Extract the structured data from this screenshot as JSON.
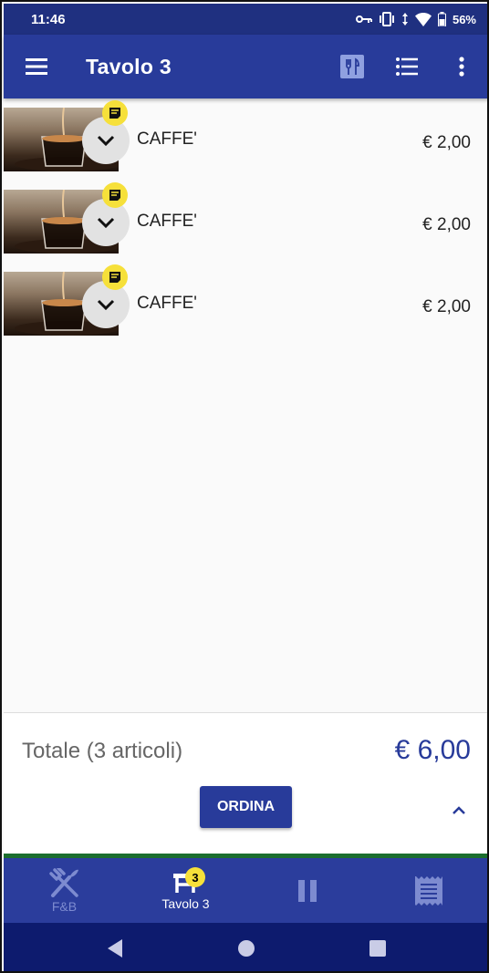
{
  "status_bar": {
    "time": "11:46",
    "battery": "56%",
    "icons": [
      "vpn-key-icon",
      "vibrate-icon",
      "data-arrows-icon",
      "wifi-icon",
      "battery-icon"
    ]
  },
  "app_bar": {
    "title": "Tavolo  3",
    "actions": [
      "restaurant-menu-icon",
      "list-icon",
      "more-vert-icon"
    ]
  },
  "items": [
    {
      "name": "CAFFE'",
      "price": "€ 2,00"
    },
    {
      "name": "CAFFE'",
      "price": "€ 2,00"
    },
    {
      "name": "CAFFE'",
      "price": "€ 2,00"
    }
  ],
  "footer": {
    "total_label": "Totale (3 articoli)",
    "total_value": "€ 6,00",
    "order_button": "ORDINA"
  },
  "bottom_nav": {
    "tabs": [
      {
        "label": "F&B",
        "icon": "fork-knife-icon",
        "active": false
      },
      {
        "label": "Tavolo  3",
        "icon": "table-icon",
        "active": true,
        "badge": "3"
      },
      {
        "label": "",
        "icon": "pause-icon",
        "active": false
      },
      {
        "label": "",
        "icon": "receipt-icon",
        "active": false
      }
    ]
  },
  "colors": {
    "primary": "#283b9a",
    "status_bar": "#1f3080",
    "accent_badge": "#f6e03a",
    "system_nav": "#0d1b6e",
    "divider_strip": "#1b6e2e"
  }
}
